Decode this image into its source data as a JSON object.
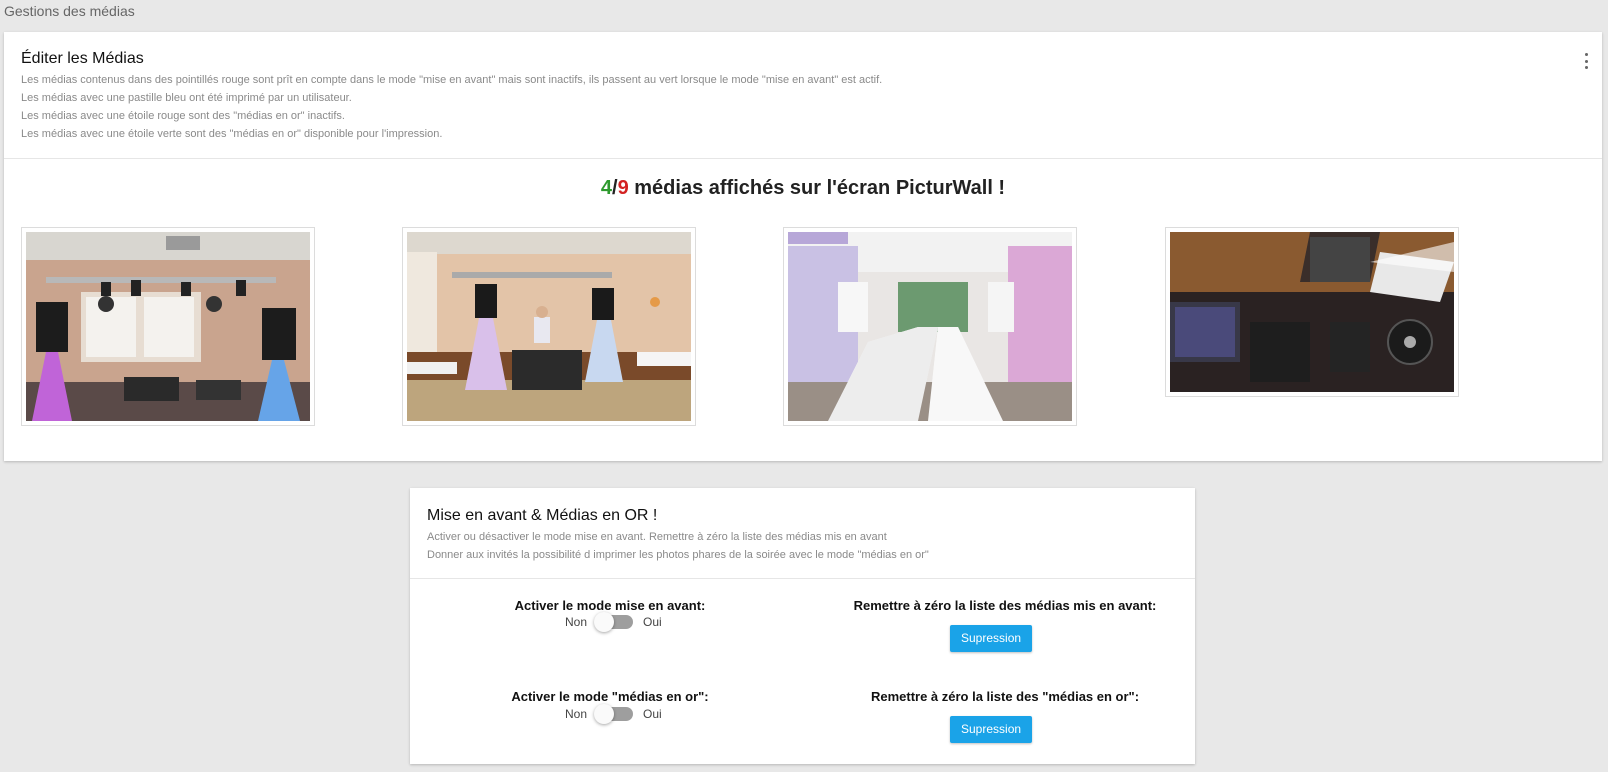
{
  "page": {
    "title": "Gestions des médias"
  },
  "editor": {
    "title": "Éditer les Médias",
    "descriptions": [
      "Les médias contenus dans des pointillés rouge sont prît en compte dans le mode \"mise en avant\" mais sont inactifs, ils passent au vert lorsque le mode \"mise en avant\" est actif.",
      "Les médias avec une pastille bleu ont été imprimé par un utilisateur.",
      "Les médias avec une étoile rouge sont des \"médias en or\" inactifs.",
      "Les médias avec une étoile verte sont des \"médias en or\" disponible pour l'impression."
    ],
    "counter": {
      "shown": "4",
      "separator": "/",
      "total": "9",
      "suffix": " médias affichés sur l'écran PicturWall !"
    },
    "menu_icon": "more-vert-icon"
  },
  "featured": {
    "title": "Mise en avant & Médias en OR !",
    "descriptions": [
      "Activer ou désactiver le mode mise en avant. Remettre à zéro la liste des médias mis en avant",
      "Donner aux invités la possibilité d imprimer les photos phares de la soirée avec le mode \"médias en or\""
    ],
    "highlight_mode": {
      "label": "Activer le mode mise en avant:",
      "off": "Non",
      "on": "Oui",
      "enabled": false
    },
    "reset_highlight": {
      "label": "Remettre à zéro la liste des médias mis en avant:",
      "button": "Supression"
    },
    "gold_mode": {
      "label": "Activer le mode \"médias en or\":",
      "off": "Non",
      "on": "Oui",
      "enabled": false
    },
    "reset_gold": {
      "label": "Remettre à zéro la liste des \"médias en or\":",
      "button": "Supression"
    }
  },
  "colors": {
    "accent": "#1aa3e8",
    "shown_count": "#2e9a2e",
    "total_count": "#d32222",
    "toggle_off": "#9e9e9e"
  }
}
